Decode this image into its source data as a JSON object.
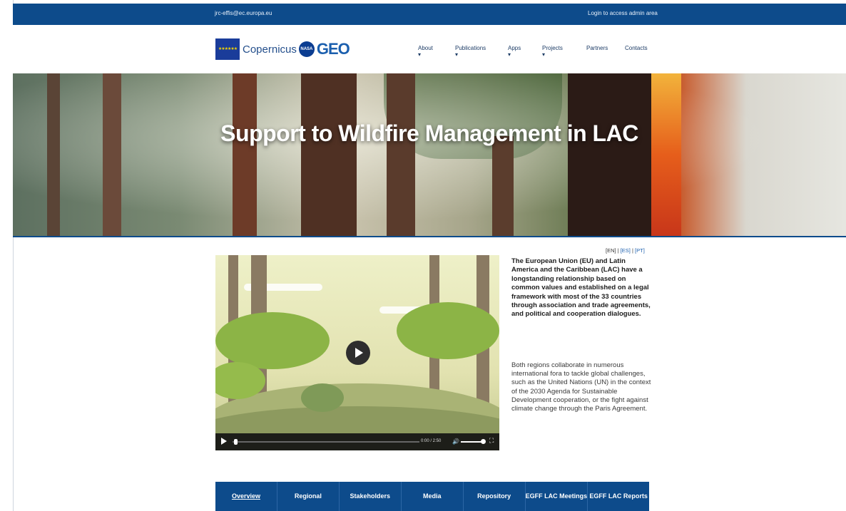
{
  "topbar": {
    "email": "jrc-effis@ec.europa.eu",
    "login": "Login to access admin area"
  },
  "header": {
    "logos": {
      "eu_flag": "eu-flag-logo",
      "copernicus": "Copernicus",
      "nasa": "NASA",
      "geo": "GEO"
    },
    "nav": [
      {
        "label": "About ▾"
      },
      {
        "label": "Publications ▾"
      },
      {
        "label": "Apps ▾"
      },
      {
        "label": "Projects ▾"
      },
      {
        "label": "Partners"
      },
      {
        "label": "Contacts"
      }
    ]
  },
  "hero": {
    "title": "Support to Wildfire Management in LAC"
  },
  "lang": {
    "en": "[EN]",
    "sep1": " | ",
    "es": "[ES]",
    "sep2": " | ",
    "pt": "[PT]"
  },
  "video": {
    "time": "0:00 / 2:50"
  },
  "content": {
    "intro": "The European Union (EU) and Latin America and the Caribbean (LAC) have a longstanding relationship based on common values and established on a legal framework with most of the 33 countries through association and trade agreements, and political and cooperation dialogues.",
    "body": "Both regions collaborate in numerous international fora to tackle global challenges, such as the United Nations (UN) in the context of the 2030 Agenda for Sustainable Development cooperation, or the fight against climate change through the Paris Agreement."
  },
  "tabs": [
    {
      "label": "Overview"
    },
    {
      "label": "Regional"
    },
    {
      "label": "Stakeholders"
    },
    {
      "label": "Media"
    },
    {
      "label": "Repository"
    },
    {
      "label": "EGFF LAC Meetings"
    },
    {
      "label": "EGFF LAC Reports"
    }
  ],
  "colors": {
    "brand_blue": "#0d4b8b",
    "link_blue": "#1b5fae"
  }
}
